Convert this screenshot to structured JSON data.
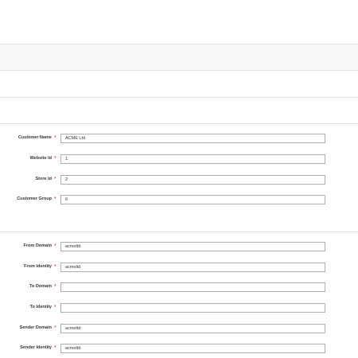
{
  "customer": {
    "fields": [
      {
        "label": "Customer Name",
        "value": "ACME Ltd"
      },
      {
        "label": "Website Id",
        "value": "1"
      },
      {
        "label": "Store Id",
        "value": "2"
      },
      {
        "label": "Customer Group",
        "value": "6"
      }
    ]
  },
  "email": {
    "fields": [
      {
        "label": "From Domain",
        "value": "acmeltd"
      },
      {
        "label": "From Identity",
        "value": "acmeltd"
      },
      {
        "label": "To Domain",
        "value": ""
      },
      {
        "label": "To Identity",
        "value": ""
      },
      {
        "label": "Sender Domain",
        "value": "acmeltd"
      },
      {
        "label": "Sender Identity",
        "value": "acmeltd"
      }
    ]
  },
  "required_marker": "*",
  "colors": {
    "required": "#e22626",
    "border": "#adadad",
    "divider": "#e3e3e3",
    "band": "#f8f8f8"
  }
}
